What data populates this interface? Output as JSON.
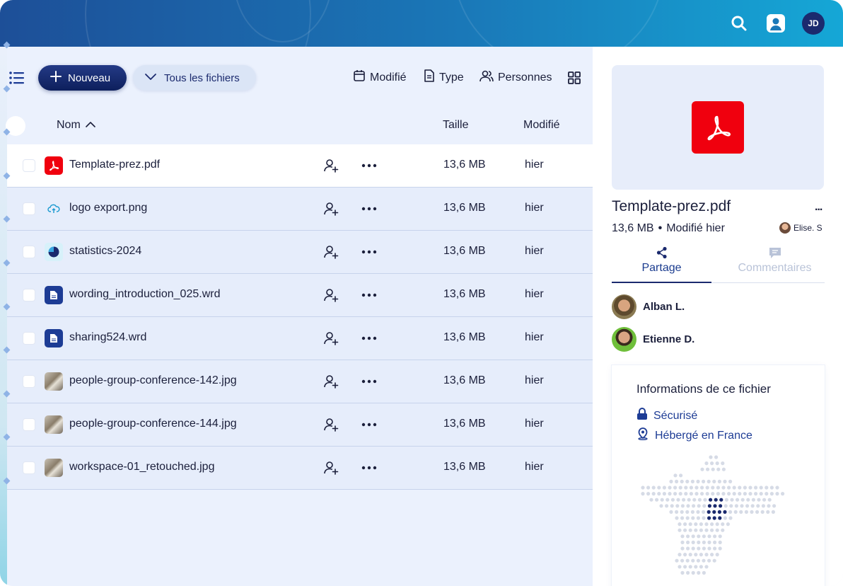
{
  "header": {
    "icons": [
      "search-icon",
      "user-account-icon"
    ],
    "avatar_initials": "JD",
    "gradient_colors": [
      "#1d4f98",
      "#15a7d6"
    ]
  },
  "toolbar": {
    "new_label": "Nouveau",
    "all_files_label": "Tous les fichiers",
    "filters": [
      {
        "label": "Modifié",
        "icon": "calendar-icon"
      },
      {
        "label": "Type",
        "icon": "document-icon"
      },
      {
        "label": "Personnes",
        "icon": "people-icon"
      }
    ]
  },
  "table": {
    "columns": {
      "name": "Nom",
      "size": "Taille",
      "modified": "Modifié"
    },
    "rows": [
      {
        "name": "Template-prez.pdf",
        "size": "13,6 MB",
        "modified": "hier",
        "icon": "pdf-icon"
      },
      {
        "name": "logo export.png",
        "size": "13,6 MB",
        "modified": "hier",
        "icon": "cloud-upload-icon"
      },
      {
        "name": "statistics-2024",
        "size": "13,6 MB",
        "modified": "hier",
        "icon": "pie-chart-icon"
      },
      {
        "name": "wording_introduction_025.wrd",
        "size": "13,6 MB",
        "modified": "hier",
        "icon": "text-document-icon"
      },
      {
        "name": "sharing524.wrd",
        "size": "13,6 MB",
        "modified": "hier",
        "icon": "text-document-icon"
      },
      {
        "name": "people-group-conference-142.jpg",
        "size": "13,6 MB",
        "modified": "hier",
        "icon": "photo-thumbnail-icon"
      },
      {
        "name": "people-group-conference-144.jpg",
        "size": "13,6 MB",
        "modified": "hier",
        "icon": "photo-thumbnail-icon"
      },
      {
        "name": "workspace-01_retouched.jpg",
        "size": "13,6 MB",
        "modified": "hier",
        "icon": "photo-thumbnail-icon"
      }
    ]
  },
  "details": {
    "file_name": "Template-prez.pdf",
    "more_label": "...",
    "size": "13,6 MB",
    "separator": "•",
    "modified": "Modifié hier",
    "owner": "Elise. S",
    "tabs": {
      "share": "Partage",
      "comments": "Commentaires"
    },
    "people": [
      {
        "name": "Alban L."
      },
      {
        "name": "Etienne D."
      }
    ],
    "info": {
      "title": "Informations de ce fichier",
      "secure": "Sécurisé",
      "hosted": "Hébergé en France"
    }
  }
}
